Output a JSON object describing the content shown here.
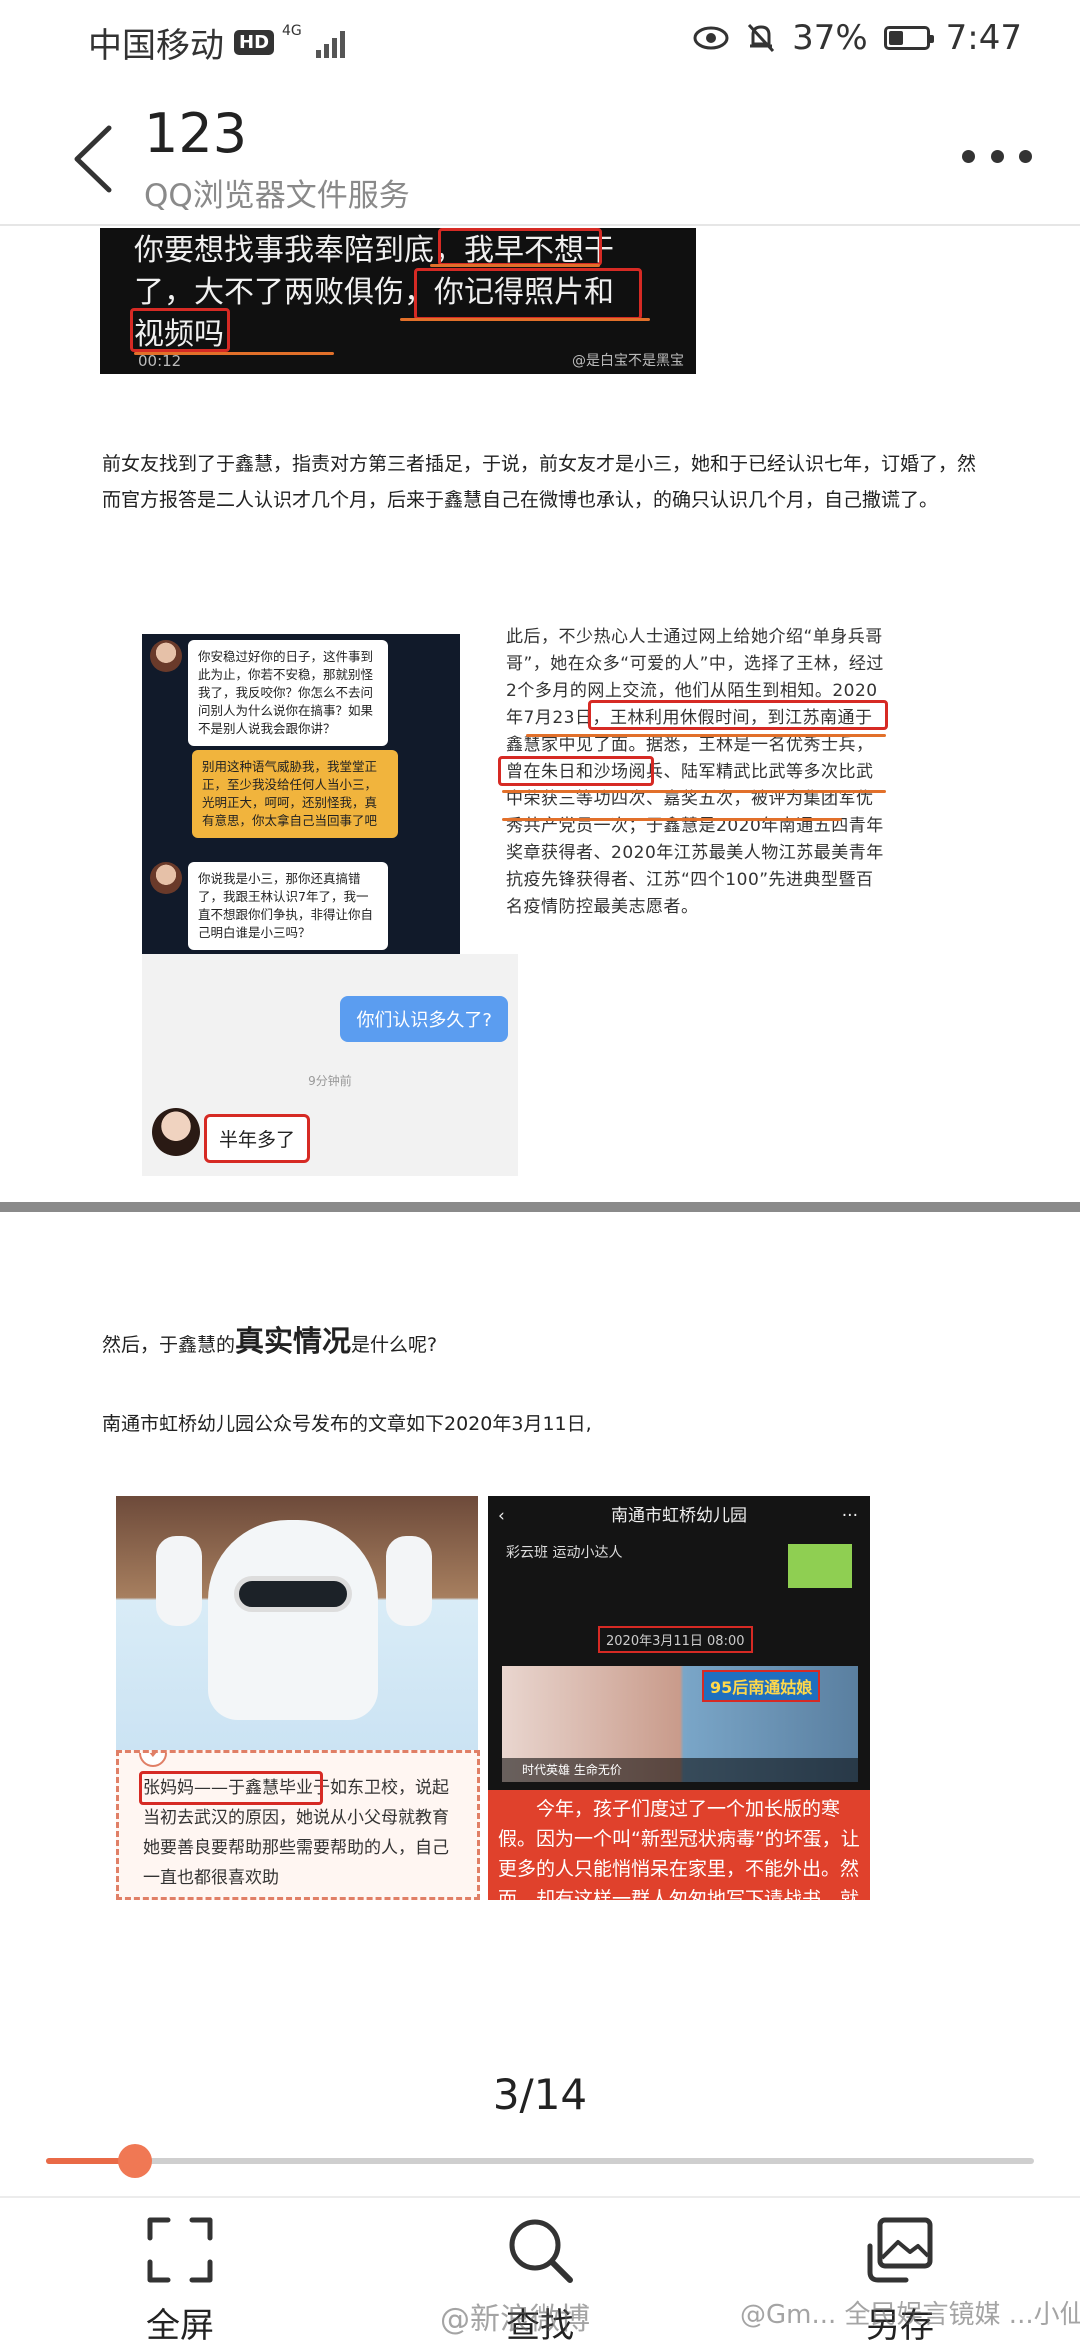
{
  "status_bar": {
    "carrier": "中国移动",
    "hd": "HD",
    "network": "4G",
    "battery_percent": "37%",
    "battery_level": 0.37,
    "time": "7:47"
  },
  "header": {
    "title": "123",
    "subtitle": "QQ浏览器文件服务"
  },
  "document": {
    "video_lines": [
      "你要想找事我奉陪到底，我早不想干",
      "了，大不了两败俱伤，你记得照片和",
      "视频吗"
    ],
    "video_time": "00:12",
    "video_watermark": "@是白宝不是黑宝",
    "para1": "前女友找到了于鑫慧，指责对方第三者插足，于说，前女友才是小三，她和于已经认识七年，订婚了，然而官方报答是二人认识才几个月，后来于鑫慧自己在微博也承认，的确只认识几个月，自己撒谎了。",
    "chat": {
      "msg1": "你安稳过好你的日子，这件事到此为止，你若不安稳，那就别怪我了，我反咬你？你怎么不去问问别人为什么说你在搞事？如果不是别人说我会跟你讲？",
      "msg2": "别用这种语气威胁我，我堂堂正正，至少我没给任何人当小三，光明正大，呵呵，还别怪我，真有意思，你太拿自己当回事了吧",
      "msg3": "你说我是小三，那你还真搞错了，我跟王林认识7年了，我一直不想跟你们争执，非得让你自己明白谁是小三吗？",
      "question": "你们认识多久了?",
      "time": "9分钟前",
      "answer": "半年多了"
    },
    "article_text": "此后，不少热心人士通过网上给她介绍“单身兵哥哥”，她在众多“可爱的人”中，选择了王林，经过2个多月的网上交流，他们从陌生到相知。2020年7月23日，王林利用休假时间，到江苏南通于鑫慧家中见了面。据悉，王林是一名优秀士兵，曾在朱日和沙场阅兵、陆军精武比武等多次比武中荣获三等功四次、嘉奖五次，被评为集团军优秀共产党员一次；于鑫慧是2020年南通五四青年奖章获得者、2020年江苏最美人物江苏最美青年抗疫先锋获得者、江苏“四个100”先进典型暨百名疫情防控最美志愿者。",
    "para2_pre": "然后，于鑫慧的",
    "para2_bold": "真实情况",
    "para2_post": "是什么呢?",
    "para3": "南通市虹桥幼儿园公众号发布的文章如下2020年3月11日,",
    "medic_card_text": "张妈妈——于鑫慧毕业于如东卫校，说起当初去武汉的原因，她说从小父母就教育她要善良要帮助那些需要帮助的人，自己一直也都很喜欢助",
    "kg": {
      "title": "南通市虹桥幼儿园",
      "sub": "彩云班 运动小达人",
      "date": "2020年3月11日 08:00",
      "badge": "95后南通姑娘",
      "caption": "时代英雄  生命无价",
      "red_text": "今年，孩子们度过了一个加长版的寒假。因为一个叫“新型冠状病毒”的坏蛋，让更多的人只能悄悄呆在家里，不能外出。然而，却有这样一群人匆匆地写下请战书，就义无反顾地昂首挺胸奔赴疫区，我们班的张浩轩妈妈就是这样一位勇敢的逆行者，她离开小家，投身大家，与病魔"
    }
  },
  "pager": {
    "label": "3/14",
    "current": 3,
    "total": 14,
    "progress": 0.09
  },
  "toolbar": {
    "fullscreen": "全屏",
    "search": "查找",
    "save": "另存"
  },
  "watermarks": {
    "left": "@新浪微博",
    "right": "@Gm... 全民娱言镜媒 ...小仙女"
  },
  "colors": {
    "accent": "#e96a47",
    "highlight_red": "#d62a24"
  }
}
